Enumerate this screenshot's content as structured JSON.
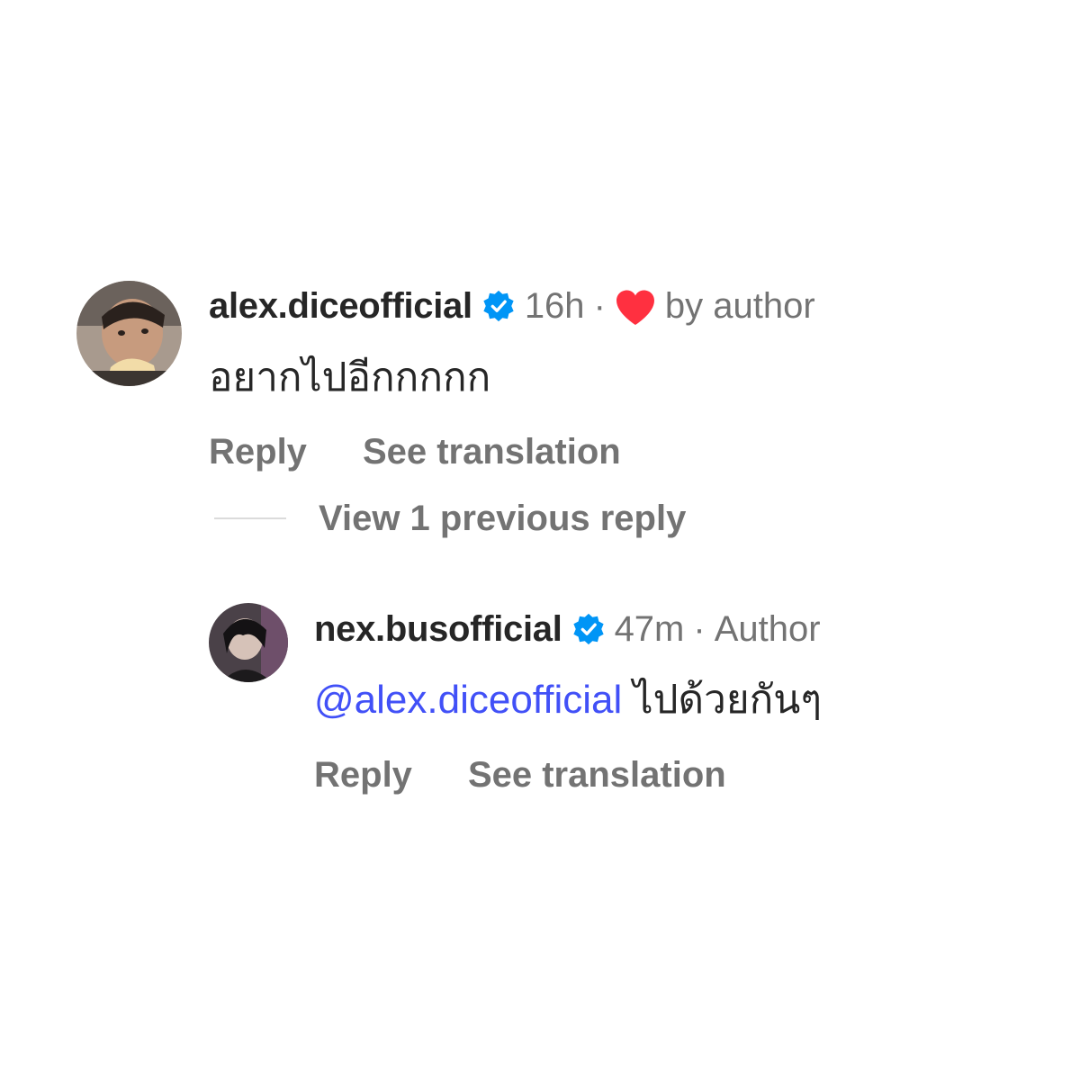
{
  "comment": {
    "username": "alex.diceofficial",
    "time": "16h",
    "separator": "·",
    "liked_label": "by author",
    "text": "อยากไปอีกกกกก",
    "reply_label": "Reply",
    "translate_label": "See translation",
    "view_replies_label": "View 1 previous reply"
  },
  "reply": {
    "username": "nex.busofficial",
    "time": "47m",
    "separator": "·",
    "badge_label": "Author",
    "mention": "@alex.diceofficial",
    "text": " ไปด้วยกันๆ",
    "reply_label": "Reply",
    "translate_label": "See translation"
  },
  "colors": {
    "verified_blue": "#0095f6",
    "heart_red": "#ff3040",
    "mention_blue": "#4150f7",
    "secondary_text": "#737373"
  },
  "icons": [
    "verified-badge-icon",
    "heart-icon"
  ]
}
